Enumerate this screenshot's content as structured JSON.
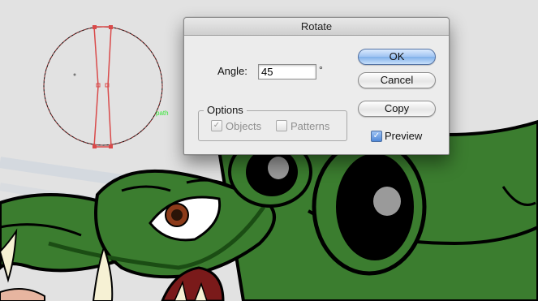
{
  "artwork": {
    "path_label": "path",
    "colors": {
      "background": "#e2e2e2",
      "creature_green": "#3b7d2f",
      "outline": "#000000",
      "selection_red": "#d94a4a",
      "path_label_green": "#39e639",
      "eye_gray": "#9a9a9a"
    }
  },
  "dialog": {
    "title": "Rotate",
    "angle_label": "Angle:",
    "angle_value": "45",
    "degree_symbol": "°",
    "options_label": "Options",
    "objects_label": "Objects",
    "objects_checked": true,
    "patterns_label": "Patterns",
    "patterns_checked": false,
    "ok_label": "OK",
    "cancel_label": "Cancel",
    "copy_label": "Copy",
    "preview_label": "Preview",
    "preview_checked": true
  }
}
